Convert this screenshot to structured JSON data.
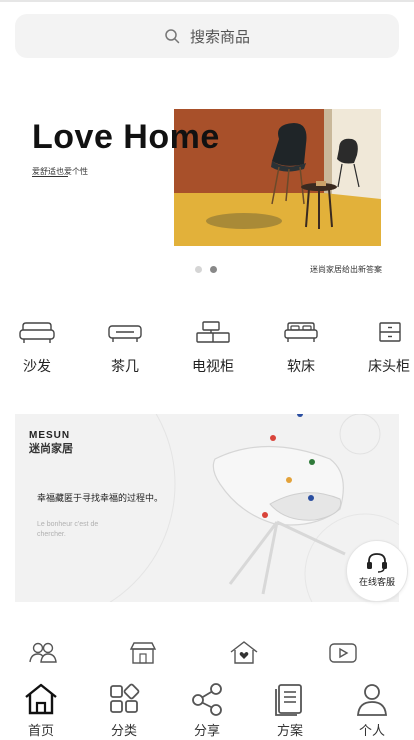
{
  "search": {
    "placeholder": "搜索商品",
    "icon": "search-icon"
  },
  "banner": {
    "title": "Love Home",
    "subtitle": "爱舒适也爱个性",
    "caption": "迷尚家居给出新答案",
    "slides": 2,
    "active_slide": 2
  },
  "categories": [
    {
      "label": "沙发",
      "icon": "sofa-icon"
    },
    {
      "label": "茶几",
      "icon": "coffee-table-icon"
    },
    {
      "label": "电视柜",
      "icon": "tv-cabinet-icon"
    },
    {
      "label": "软床",
      "icon": "bed-icon"
    },
    {
      "label": "床头柜",
      "icon": "nightstand-icon"
    }
  ],
  "promo": {
    "brand": "MESUN",
    "brand_cn": "迷尚家居",
    "slogan": "幸福藏匿于寻找幸福的过程中。",
    "french": "Le bonheur c'est de chercher."
  },
  "service": {
    "label": "在线客服",
    "icon": "headset-icon"
  },
  "shortcuts": [
    {
      "icon": "users-icon"
    },
    {
      "icon": "store-icon"
    },
    {
      "icon": "heart-house-icon"
    },
    {
      "icon": "video-play-icon"
    }
  ],
  "tabbar": [
    {
      "label": "首页",
      "icon": "home-icon",
      "active": true
    },
    {
      "label": "分类",
      "icon": "category-icon"
    },
    {
      "label": "分享",
      "icon": "share-icon"
    },
    {
      "label": "方案",
      "icon": "document-icon"
    },
    {
      "label": "个人",
      "icon": "user-icon"
    }
  ],
  "colors": {
    "search_bg": "#f3f3f3",
    "promo_bg": "#f2f2f2",
    "banner_wall": "#a8502a",
    "banner_floor": "#e3b43c",
    "dot_active": "#888888",
    "dot_inactive": "#d5d5d5"
  }
}
